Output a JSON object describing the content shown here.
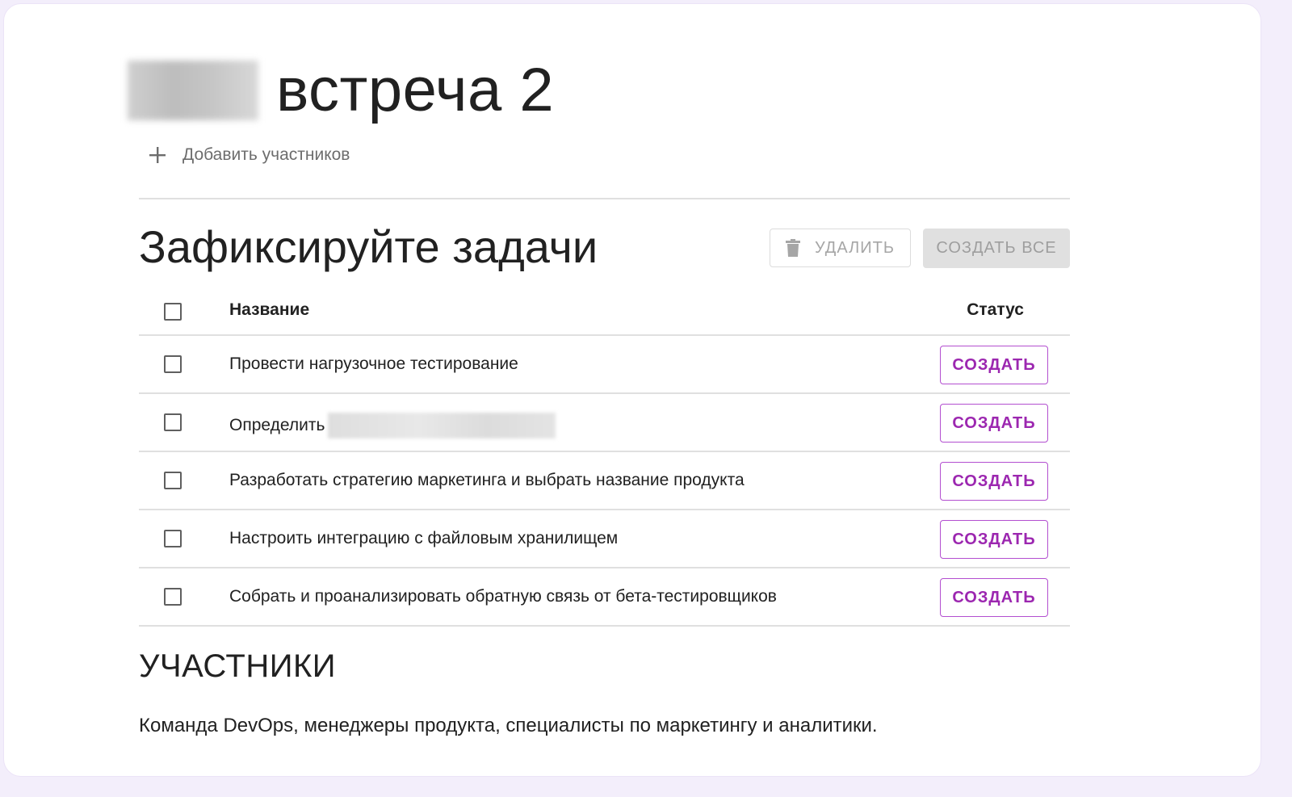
{
  "meeting": {
    "title": "встреча 2",
    "add_participants_label": "Добавить участников"
  },
  "tasks_section": {
    "heading": "Зафиксируйте задачи",
    "delete_label": "УДАЛИТЬ",
    "create_all_label": "СОЗДАТЬ ВСЕ",
    "columns": {
      "name": "Название",
      "status": "Статус"
    },
    "rows": [
      {
        "name": "Провести нагрузочное тестирование",
        "action": "СОЗДАТЬ"
      },
      {
        "name": "Определить",
        "action": "СОЗДАТЬ"
      },
      {
        "name": "Разработать стратегию маркетинга и выбрать название продукта",
        "action": "СОЗДАТЬ"
      },
      {
        "name": "Настроить интеграцию с файловым хранилищем",
        "action": "СОЗДАТЬ"
      },
      {
        "name": "Собрать и проанализировать обратную связь от бета-тестировщиков",
        "action": "СОЗДАТЬ"
      }
    ]
  },
  "participants_section": {
    "heading": "УЧАСТНИКИ",
    "text": "Команда DevOps, менеджеры продукта, специалисты по маркетингу и аналитики."
  },
  "icons": {
    "add": "plus-icon",
    "delete": "trash-icon"
  },
  "colors": {
    "accent": "#9c27b0",
    "disabled_text": "#a6a6a6",
    "disabled_bg": "#e0e0e0",
    "divider": "#e0e0e0",
    "frame_border": "#ebe3f7"
  }
}
